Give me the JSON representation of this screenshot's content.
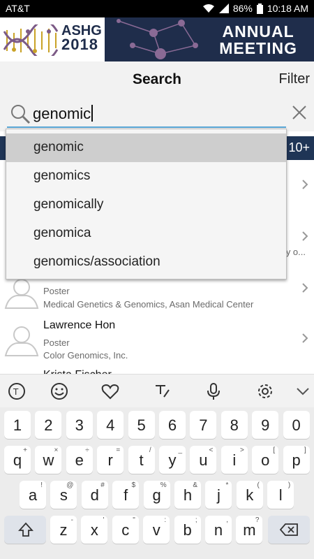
{
  "status": {
    "carrier": "AT&T",
    "battery": "86%",
    "time": "10:18 AM"
  },
  "banner": {
    "org": "ASHG",
    "year": "2018",
    "line1": "ANNUAL",
    "line2": "MEETING"
  },
  "header": {
    "title": "Search",
    "filter": "Filter"
  },
  "search": {
    "query": "genomic"
  },
  "results": {
    "count": "10+",
    "rows": [
      {
        "name": "",
        "type": "Poster",
        "org": "Medical Genetics & Genomics, Asan Medical Center"
      },
      {
        "name": "Lawrence Hon",
        "type": "Poster",
        "org": "Color Genomics, Inc."
      },
      {
        "name": "Krista Fischer",
        "type": "",
        "org": ""
      }
    ],
    "partial_text": "y o..."
  },
  "suggestions": [
    "genomic",
    "genomics",
    "genomically",
    "genomica",
    "genomics/association"
  ],
  "keyboard": {
    "numbers": [
      "1",
      "2",
      "3",
      "4",
      "5",
      "6",
      "7",
      "8",
      "9",
      "0"
    ],
    "row1": [
      [
        "q",
        "+"
      ],
      [
        "w",
        "×"
      ],
      [
        "e",
        "÷"
      ],
      [
        "r",
        "="
      ],
      [
        "t",
        "/"
      ],
      [
        "y",
        "_"
      ],
      [
        "u",
        "<"
      ],
      [
        "i",
        ">"
      ],
      [
        "o",
        "["
      ],
      [
        "p",
        "]"
      ]
    ],
    "row2": [
      [
        "a",
        "!"
      ],
      [
        "s",
        "@"
      ],
      [
        "d",
        "#"
      ],
      [
        "f",
        "$"
      ],
      [
        "g",
        "%"
      ],
      [
        "h",
        "&"
      ],
      [
        "j",
        "*"
      ],
      [
        "k",
        "("
      ],
      [
        "l",
        ")"
      ]
    ],
    "row3": [
      [
        "z",
        "-"
      ],
      [
        "x",
        "'"
      ],
      [
        "c",
        "\""
      ],
      [
        "v",
        ":"
      ],
      [
        "b",
        ";"
      ],
      [
        "n",
        ","
      ],
      [
        "m",
        "?"
      ]
    ]
  }
}
